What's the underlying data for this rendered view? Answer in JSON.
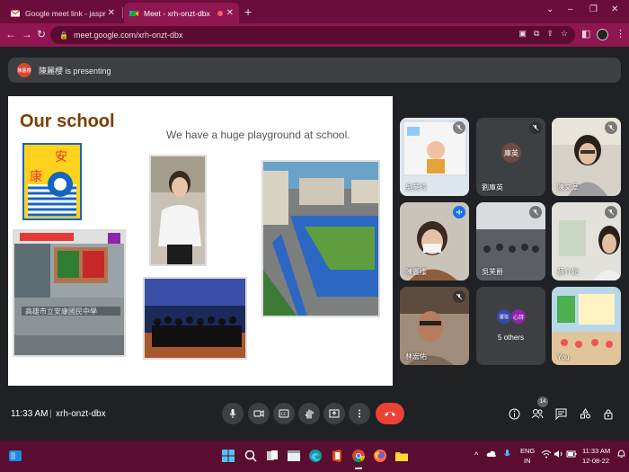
{
  "browser": {
    "tabs": [
      {
        "title": "Google meet link - jaspreet.k@t"
      },
      {
        "title": "Meet - xrh-onzt-dbx"
      }
    ],
    "new_tab": "+",
    "window_controls": {
      "collapse": "⌄",
      "minimize": "–",
      "restore": "❐",
      "close": "✕"
    },
    "url": "meet.google.com/xrh-onzt-dbx"
  },
  "presenting": {
    "avatar_text": "陳麗櫻",
    "text": "陳麗櫻 is presenting"
  },
  "slide": {
    "title": "Our school",
    "caption": "We have a huge playground at school.",
    "logo_chars": [
      "安",
      "康"
    ],
    "photo_banner_text": "高雄市立安康國民中學"
  },
  "participants": [
    {
      "name": "吳芙玲",
      "muted": true
    },
    {
      "name": "劉庫英",
      "avatar": "庫英",
      "muted": true
    },
    {
      "name": "陳文華",
      "muted": true
    },
    {
      "name": "陳麗櫻",
      "speaking": true
    },
    {
      "name": "吳芙爵",
      "muted": true
    },
    {
      "name": "蔡介妃",
      "muted": true
    },
    {
      "name": "林宏佑",
      "muted": true
    },
    {
      "name": "5 others",
      "avatars": [
        "慶弦",
        "心詩"
      ]
    },
    {
      "name": "You"
    }
  ],
  "controls": {
    "time": "11:33 AM",
    "separator": "|",
    "meeting_code": "xrh-onzt-dbx",
    "people_count": "14"
  },
  "taskbar": {
    "lang": "ENG",
    "region": "IN",
    "time": "11:33 AM",
    "date": "12-08-22"
  },
  "colors": {
    "accent_chrome": "#8f1650",
    "end_call": "#ea4335",
    "speaking": "#8ab4f8"
  }
}
